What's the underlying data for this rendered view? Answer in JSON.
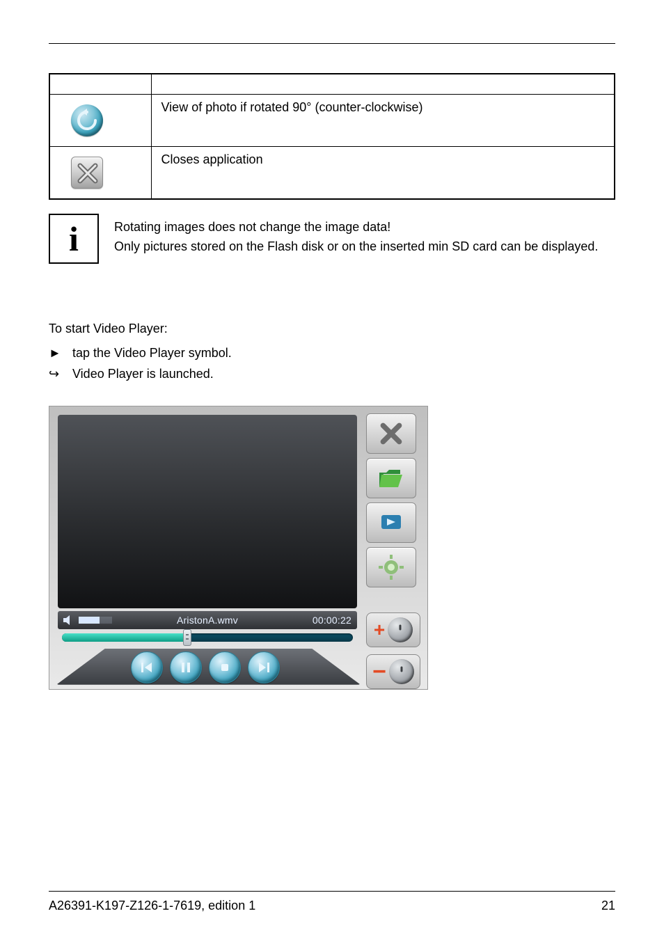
{
  "table": {
    "row1_text": "View of photo if rotated 90° (counter-clockwise)",
    "row2_text": "Closes application"
  },
  "info": {
    "symbol": "i",
    "line1": "Rotating images does not change the image data!",
    "line2": "Only pictures stored on the Flash disk or on the inserted min SD card can be displayed."
  },
  "instructions": {
    "lead": "To start Video Player:",
    "item1": "tap the Video Player symbol.",
    "item2": "Video Player is launched.",
    "marker1": "►",
    "marker2": "↪"
  },
  "player": {
    "filename": "AristonA.wmv",
    "time": "00:00:22"
  },
  "footer": {
    "left": "A26391-K197-Z126-1-7619, edition 1",
    "right": "21"
  }
}
